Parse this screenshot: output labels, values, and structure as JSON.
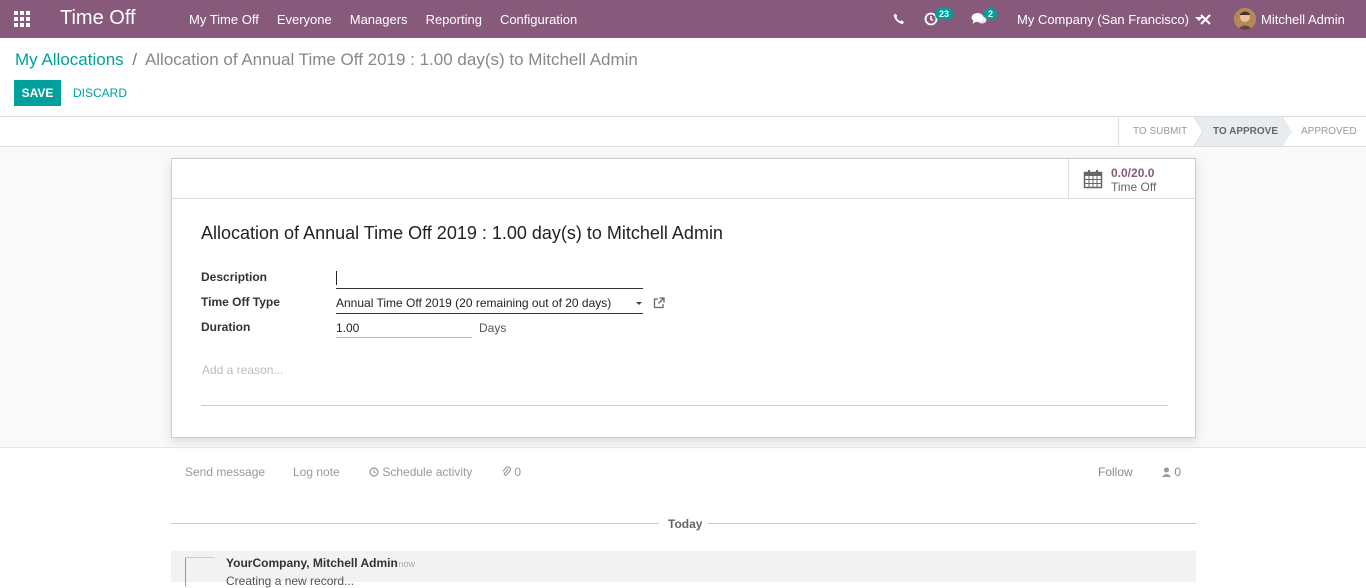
{
  "navbar": {
    "app_title": "Time Off",
    "menu": [
      "My Time Off",
      "Everyone",
      "Managers",
      "Reporting",
      "Configuration"
    ],
    "activity_count": "23",
    "message_count": "2",
    "company": "My Company (San Francisco)",
    "user": "Mitchell Admin",
    "icons": [
      "apps-grid-icon",
      "phone-icon",
      "clock-icon",
      "chat-icon",
      "close-icon"
    ]
  },
  "breadcrumb": {
    "parent": "My Allocations",
    "separator": "/",
    "current": "Allocation of Annual Time Off 2019 : 1.00 day(s) to Mitchell Admin"
  },
  "actions": {
    "save": "SAVE",
    "discard": "DISCARD"
  },
  "status": {
    "stages": [
      "TO SUBMIT",
      "TO APPROVE",
      "APPROVED"
    ],
    "active": "TO APPROVE"
  },
  "stat_button": {
    "value": "0.0/20.0",
    "label": "Time Off"
  },
  "form": {
    "title": "Allocation of Annual Time Off 2019 : 1.00 day(s) to Mitchell Admin",
    "description_label": "Description",
    "description_value": "",
    "type_label": "Time Off Type",
    "type_value": "Annual Time Off 2019 (20 remaining out of 20 days)",
    "duration_label": "Duration",
    "duration_value": "1.00",
    "duration_unit": "Days",
    "reason_placeholder": "Add a reason..."
  },
  "chatter": {
    "send_message": "Send message",
    "log_note": "Log note",
    "schedule_activity": "Schedule activity",
    "attachments": "0",
    "follow": "Follow",
    "followers": "0",
    "day_separator": "Today",
    "message": {
      "author": "YourCompany, Mitchell Admin",
      "date": "- now",
      "body": "Creating a new record..."
    }
  },
  "colors": {
    "brand": "#875a7b",
    "accent": "#00a09d"
  }
}
